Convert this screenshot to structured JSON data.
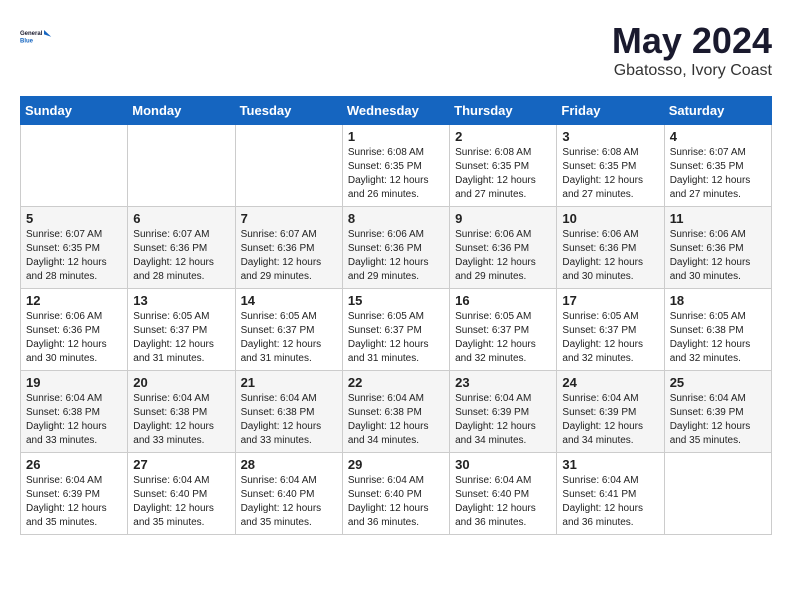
{
  "header": {
    "logo_line1": "General",
    "logo_line2": "Blue",
    "month": "May 2024",
    "location": "Gbatosso, Ivory Coast"
  },
  "weekdays": [
    "Sunday",
    "Monday",
    "Tuesday",
    "Wednesday",
    "Thursday",
    "Friday",
    "Saturday"
  ],
  "weeks": [
    [
      {
        "day": "",
        "info": ""
      },
      {
        "day": "",
        "info": ""
      },
      {
        "day": "",
        "info": ""
      },
      {
        "day": "1",
        "info": "Sunrise: 6:08 AM\nSunset: 6:35 PM\nDaylight: 12 hours\nand 26 minutes."
      },
      {
        "day": "2",
        "info": "Sunrise: 6:08 AM\nSunset: 6:35 PM\nDaylight: 12 hours\nand 27 minutes."
      },
      {
        "day": "3",
        "info": "Sunrise: 6:08 AM\nSunset: 6:35 PM\nDaylight: 12 hours\nand 27 minutes."
      },
      {
        "day": "4",
        "info": "Sunrise: 6:07 AM\nSunset: 6:35 PM\nDaylight: 12 hours\nand 27 minutes."
      }
    ],
    [
      {
        "day": "5",
        "info": "Sunrise: 6:07 AM\nSunset: 6:35 PM\nDaylight: 12 hours\nand 28 minutes."
      },
      {
        "day": "6",
        "info": "Sunrise: 6:07 AM\nSunset: 6:36 PM\nDaylight: 12 hours\nand 28 minutes."
      },
      {
        "day": "7",
        "info": "Sunrise: 6:07 AM\nSunset: 6:36 PM\nDaylight: 12 hours\nand 29 minutes."
      },
      {
        "day": "8",
        "info": "Sunrise: 6:06 AM\nSunset: 6:36 PM\nDaylight: 12 hours\nand 29 minutes."
      },
      {
        "day": "9",
        "info": "Sunrise: 6:06 AM\nSunset: 6:36 PM\nDaylight: 12 hours\nand 29 minutes."
      },
      {
        "day": "10",
        "info": "Sunrise: 6:06 AM\nSunset: 6:36 PM\nDaylight: 12 hours\nand 30 minutes."
      },
      {
        "day": "11",
        "info": "Sunrise: 6:06 AM\nSunset: 6:36 PM\nDaylight: 12 hours\nand 30 minutes."
      }
    ],
    [
      {
        "day": "12",
        "info": "Sunrise: 6:06 AM\nSunset: 6:36 PM\nDaylight: 12 hours\nand 30 minutes."
      },
      {
        "day": "13",
        "info": "Sunrise: 6:05 AM\nSunset: 6:37 PM\nDaylight: 12 hours\nand 31 minutes."
      },
      {
        "day": "14",
        "info": "Sunrise: 6:05 AM\nSunset: 6:37 PM\nDaylight: 12 hours\nand 31 minutes."
      },
      {
        "day": "15",
        "info": "Sunrise: 6:05 AM\nSunset: 6:37 PM\nDaylight: 12 hours\nand 31 minutes."
      },
      {
        "day": "16",
        "info": "Sunrise: 6:05 AM\nSunset: 6:37 PM\nDaylight: 12 hours\nand 32 minutes."
      },
      {
        "day": "17",
        "info": "Sunrise: 6:05 AM\nSunset: 6:37 PM\nDaylight: 12 hours\nand 32 minutes."
      },
      {
        "day": "18",
        "info": "Sunrise: 6:05 AM\nSunset: 6:38 PM\nDaylight: 12 hours\nand 32 minutes."
      }
    ],
    [
      {
        "day": "19",
        "info": "Sunrise: 6:04 AM\nSunset: 6:38 PM\nDaylight: 12 hours\nand 33 minutes."
      },
      {
        "day": "20",
        "info": "Sunrise: 6:04 AM\nSunset: 6:38 PM\nDaylight: 12 hours\nand 33 minutes."
      },
      {
        "day": "21",
        "info": "Sunrise: 6:04 AM\nSunset: 6:38 PM\nDaylight: 12 hours\nand 33 minutes."
      },
      {
        "day": "22",
        "info": "Sunrise: 6:04 AM\nSunset: 6:38 PM\nDaylight: 12 hours\nand 34 minutes."
      },
      {
        "day": "23",
        "info": "Sunrise: 6:04 AM\nSunset: 6:39 PM\nDaylight: 12 hours\nand 34 minutes."
      },
      {
        "day": "24",
        "info": "Sunrise: 6:04 AM\nSunset: 6:39 PM\nDaylight: 12 hours\nand 34 minutes."
      },
      {
        "day": "25",
        "info": "Sunrise: 6:04 AM\nSunset: 6:39 PM\nDaylight: 12 hours\nand 35 minutes."
      }
    ],
    [
      {
        "day": "26",
        "info": "Sunrise: 6:04 AM\nSunset: 6:39 PM\nDaylight: 12 hours\nand 35 minutes."
      },
      {
        "day": "27",
        "info": "Sunrise: 6:04 AM\nSunset: 6:40 PM\nDaylight: 12 hours\nand 35 minutes."
      },
      {
        "day": "28",
        "info": "Sunrise: 6:04 AM\nSunset: 6:40 PM\nDaylight: 12 hours\nand 35 minutes."
      },
      {
        "day": "29",
        "info": "Sunrise: 6:04 AM\nSunset: 6:40 PM\nDaylight: 12 hours\nand 36 minutes."
      },
      {
        "day": "30",
        "info": "Sunrise: 6:04 AM\nSunset: 6:40 PM\nDaylight: 12 hours\nand 36 minutes."
      },
      {
        "day": "31",
        "info": "Sunrise: 6:04 AM\nSunset: 6:41 PM\nDaylight: 12 hours\nand 36 minutes."
      },
      {
        "day": "",
        "info": ""
      }
    ]
  ]
}
